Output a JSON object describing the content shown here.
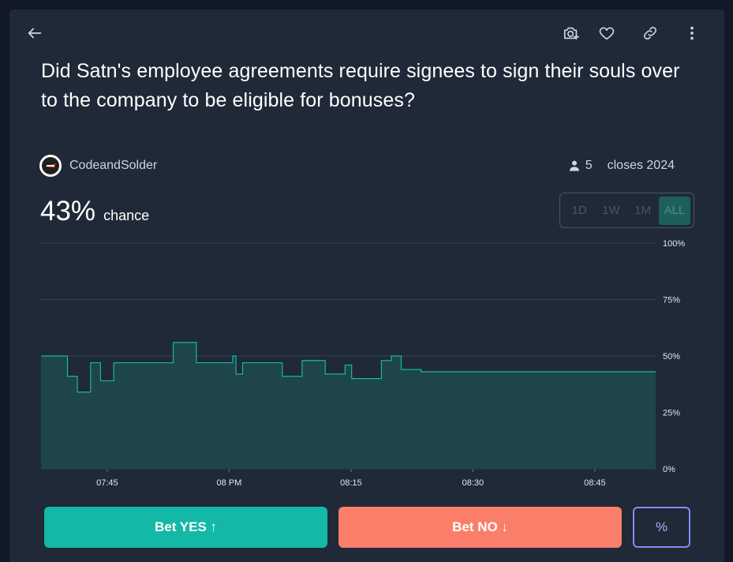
{
  "market": {
    "title": "Did Satn's employee agreements require signees to sign their souls over to the company to be eligible for bonuses?",
    "creator": "CodeandSolder",
    "traders": "5",
    "closes": "closes 2024",
    "probability": "43%",
    "probability_label": "chance"
  },
  "header": {
    "icons": [
      "back-arrow-icon",
      "camera-plus-icon",
      "heart-icon",
      "link-icon",
      "more-vertical-icon"
    ]
  },
  "time_ranges": [
    "1D",
    "1W",
    "1M",
    "ALL"
  ],
  "selected_range": "ALL",
  "actions": {
    "yes_label": "Bet YES ↑",
    "no_label": "Bet NO ↓",
    "percent_label": "%"
  },
  "colors": {
    "accent": "#14b8a6",
    "no": "#fb7e6a",
    "line": "#14b8a6",
    "area": "#1e4a4a",
    "percent_border": "#818cf8"
  },
  "chart_data": {
    "type": "area",
    "y_ticks": [
      "100%",
      "75%",
      "50%",
      "25%",
      "0%"
    ],
    "x_ticks": [
      "07:45",
      "08 PM",
      "08:15",
      "08:30",
      "08:45"
    ],
    "ylim": [
      0,
      100
    ],
    "x_range_minutes": [
      -12.3,
      6.3
    ],
    "step_points": [
      {
        "x": -12.3,
        "y": 50
      },
      {
        "x": -11.5,
        "y": 41
      },
      {
        "x": -11.2,
        "y": 34
      },
      {
        "x": -10.8,
        "y": 47
      },
      {
        "x": -10.5,
        "y": 39
      },
      {
        "x": -10.1,
        "y": 47
      },
      {
        "x": -8.3,
        "y": 56
      },
      {
        "x": -7.6,
        "y": 47
      },
      {
        "x": -6.5,
        "y": 50
      },
      {
        "x": -6.4,
        "y": 42
      },
      {
        "x": -6.2,
        "y": 47
      },
      {
        "x": -5.0,
        "y": 41
      },
      {
        "x": -4.4,
        "y": 48
      },
      {
        "x": -3.7,
        "y": 42
      },
      {
        "x": -3.1,
        "y": 46
      },
      {
        "x": -2.9,
        "y": 40
      },
      {
        "x": -2.0,
        "y": 48
      },
      {
        "x": -1.7,
        "y": 50
      },
      {
        "x": -1.4,
        "y": 44
      },
      {
        "x": -0.8,
        "y": 43
      },
      {
        "x": 6.3,
        "y": 43
      }
    ]
  }
}
